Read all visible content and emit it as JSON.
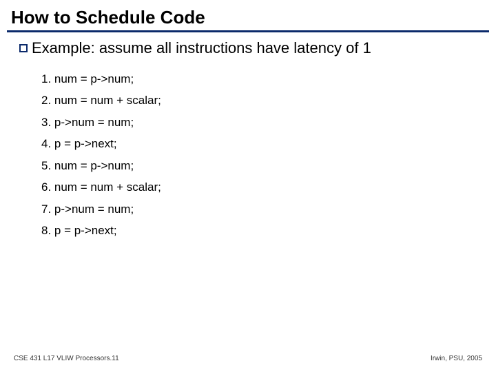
{
  "title": "How to Schedule Code",
  "bullet": {
    "text": "Example: assume all instructions have latency of 1"
  },
  "code": {
    "items": [
      "1. num = p->num;",
      "2. num = num + scalar;",
      "3. p->num = num;",
      "4. p = p->next;",
      "5. num = p->num;",
      "6. num = num + scalar;",
      "7. p->num = num;",
      "8. p = p->next;"
    ]
  },
  "footer": {
    "left": "CSE 431  L17 VLIW Processors.11",
    "right": "Irwin, PSU, 2005"
  }
}
